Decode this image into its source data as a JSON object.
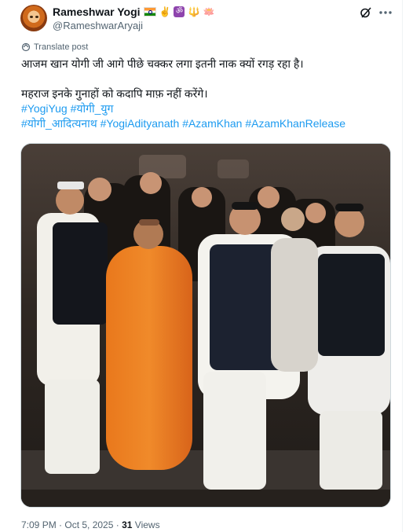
{
  "post": {
    "author_name": "Rameshwar Yogi",
    "author_handle": "@RameshwarAryaji",
    "name_emojis": [
      "🇮🇳",
      "✌️",
      "ॐ",
      "🔱",
      "🪷"
    ],
    "translate_label": "Translate post",
    "text_lines": [
      "आजम खान योगी जी आगे पीछे चक्कर लगा इतनी नाक क्यों रगड़ रहा है।",
      "महराज इनके गुनाहों को कदापि माफ़ नहीं करेंगे।"
    ],
    "hashtags_line1": [
      "#YogiYug",
      "#योगी_युग"
    ],
    "hashtags_line2": [
      "#योगी_आदित्यनाथ",
      "#YogiAdityanath",
      "#AzamKhan",
      "#AzamKhanRelease"
    ],
    "timestamp": "7:09 PM · Oct 5, 2025 ·",
    "views_count": "31",
    "views_label": "Views"
  },
  "icons": {
    "grok": "grok-icon",
    "more": "more-icon",
    "translate": "translate-icon"
  },
  "colors": {
    "link": "#1d9bf0",
    "secondary_text": "#536471",
    "primary_text": "#0f1419"
  }
}
